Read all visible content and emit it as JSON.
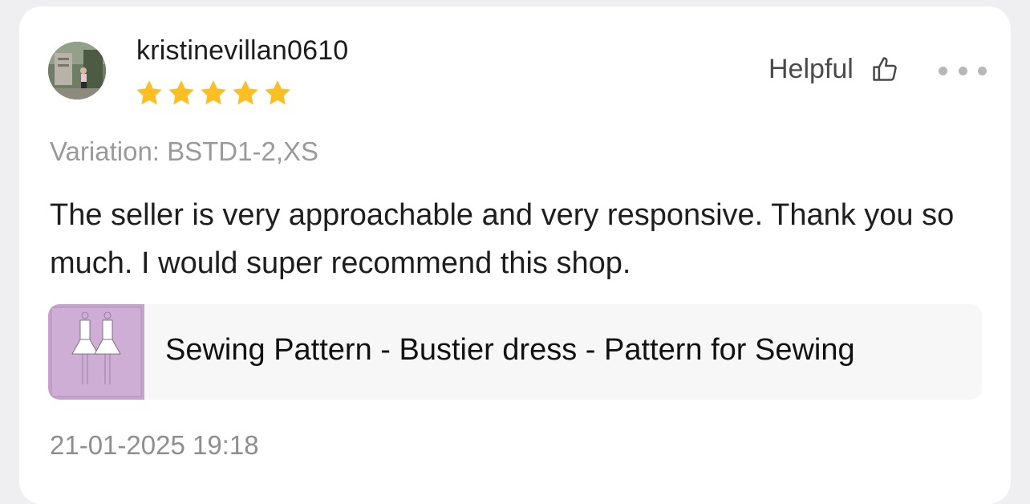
{
  "review": {
    "username": "kristinevillan0610",
    "rating": 5,
    "rating_max": 5,
    "helpful_label": "Helpful",
    "variation": "Variation: BSTD1-2,XS",
    "text": "The seller is very approachable and very responsive. Thank you so much. I would super recommend this shop.",
    "product_title": "Sewing Pattern - Bustier dress - Pattern for Sewing",
    "timestamp": "21-01-2025 19:18"
  },
  "icons": {
    "avatar": "user-avatar-photo",
    "star": "star-icon",
    "helpful": "thumbs-up-icon",
    "more": "more-options-icon",
    "product": "product-thumbnail"
  },
  "colors": {
    "star": "#fbbf24",
    "card": "#ffffff",
    "page_bg": "#efeff1",
    "product_bg": "#f7f7f8",
    "product_thumb": "#c9a3cf"
  }
}
